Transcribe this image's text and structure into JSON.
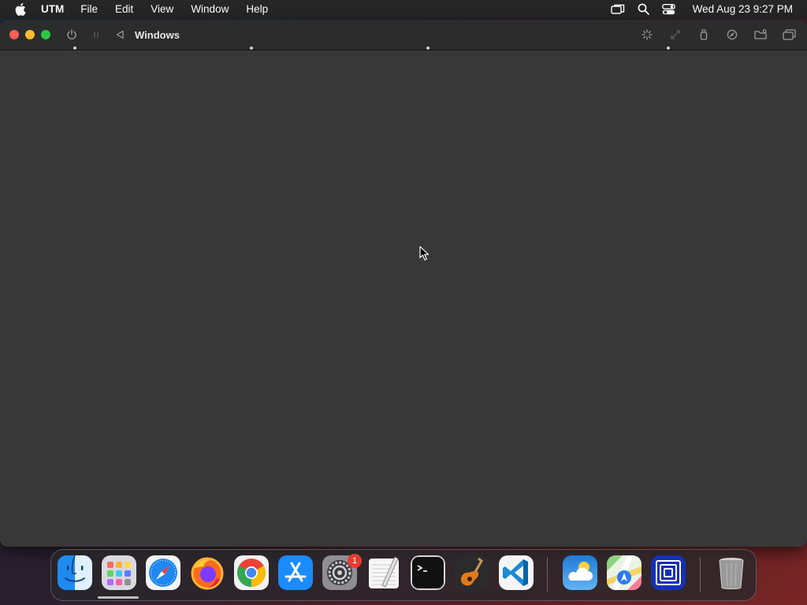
{
  "menubar": {
    "app_name": "UTM",
    "menus": [
      "File",
      "Edit",
      "View",
      "Window",
      "Help"
    ],
    "clock": "Wed Aug 23  9:27 PM",
    "status_icons": [
      "screen-mirroring-icon",
      "spotlight-search-icon",
      "control-center-icon"
    ]
  },
  "window": {
    "title": "Windows",
    "toolbar_left": [
      "power-icon",
      "pause-icon",
      "back-icon"
    ],
    "toolbar_right": [
      "capture-input-icon",
      "resize-icon",
      "usb-icon",
      "drives-icon",
      "shared-folder-icon",
      "windows-icon"
    ]
  },
  "dock": {
    "apps": [
      "Finder",
      "Launchpad",
      "Safari",
      "Firefox",
      "Google Chrome",
      "App Store",
      "System Settings",
      "TextEdit",
      "Terminal",
      "GarageBand",
      "Visual Studio Code",
      "Weather",
      "Maps",
      "UTM",
      "Trash"
    ],
    "settings_badge": "1"
  }
}
